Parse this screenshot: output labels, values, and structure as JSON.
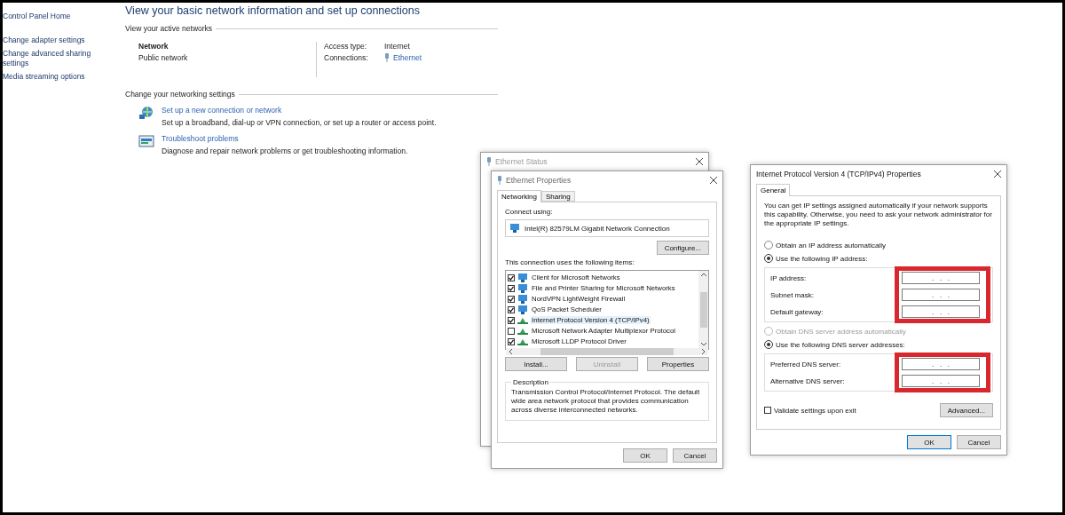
{
  "sidebar": {
    "items": [
      {
        "label": "Control Panel Home"
      },
      {
        "label": "Change adapter settings"
      },
      {
        "label": "Change advanced sharing settings"
      },
      {
        "label": "Media streaming options"
      }
    ]
  },
  "main": {
    "title": "View your basic network information and set up connections",
    "active_heading": "View your active networks",
    "network": {
      "name": "Network",
      "type": "Public network"
    },
    "access": {
      "label": "Access type:",
      "value": "Internet"
    },
    "connections": {
      "label": "Connections:",
      "value": "Ethernet"
    },
    "change_heading": "Change your networking settings",
    "tasks": [
      {
        "kind": "setup",
        "link": "Set up a new connection or network",
        "description": "Set up a broadband, dial-up or VPN connection, or set up a router or access point."
      },
      {
        "kind": "troubleshoot",
        "link": "Troubleshoot problems",
        "description": "Diagnose and repair network problems or get troubleshooting information."
      }
    ]
  },
  "status_window": {
    "title": "Ethernet Status"
  },
  "ethernet_window": {
    "title": "Ethernet Properties",
    "tabs": [
      {
        "label": "Networking",
        "selected": true
      },
      {
        "label": "Sharing",
        "selected": false
      }
    ],
    "connect_label": "Connect using:",
    "adapter": "Intel(R) 82579LM Gigabit Network Connection",
    "configure": "Configure...",
    "items_label": "This connection uses the following items:",
    "items": [
      {
        "kind": "client",
        "label": "Client for Microsoft Networks",
        "checked": true,
        "selected": false
      },
      {
        "kind": "client",
        "label": "File and Printer Sharing for Microsoft Networks",
        "checked": true,
        "selected": false
      },
      {
        "kind": "client",
        "label": "NordVPN LightWeight Firewall",
        "checked": true,
        "selected": false
      },
      {
        "kind": "client",
        "label": "QoS Packet Scheduler",
        "checked": true,
        "selected": false
      },
      {
        "kind": "protocol",
        "label": "Internet Protocol Version 4 (TCP/IPv4)",
        "checked": true,
        "selected": true
      },
      {
        "kind": "protocol",
        "label": "Microsoft Network Adapter Multiplexor Protocol",
        "checked": false,
        "selected": false
      },
      {
        "kind": "protocol",
        "label": "Microsoft LLDP Protocol Driver",
        "checked": true,
        "selected": false
      }
    ],
    "buttons": [
      {
        "label": "Install...",
        "disabled": false
      },
      {
        "label": "Uninstall",
        "disabled": true
      },
      {
        "label": "Properties",
        "disabled": false
      }
    ],
    "description_title": "Description",
    "description": "Transmission Control Protocol/Internet Protocol. The default wide area network protocol that provides communication across diverse interconnected networks.",
    "ok": "OK",
    "cancel": "Cancel"
  },
  "ipv4_window": {
    "title": "Internet Protocol Version 4 (TCP/IPv4) Properties",
    "tabs": [
      {
        "label": "General",
        "selected": true
      }
    ],
    "intro": "You can get IP settings assigned automatically if your network supports this capability. Otherwise, you need to ask your network administrator for the appropriate IP settings.",
    "ip_options": [
      {
        "label": "Obtain an IP address automatically",
        "selected": false,
        "disabled": false
      },
      {
        "label": "Use the following IP address:",
        "selected": true,
        "disabled": false
      }
    ],
    "ip_fields": [
      {
        "label": "IP address:",
        "value": ".   .   ."
      },
      {
        "label": "Subnet mask:",
        "value": ".   .   ."
      },
      {
        "label": "Default gateway:",
        "value": ".   .   ."
      }
    ],
    "ip_highlighted": true,
    "dns_options": [
      {
        "label": "Obtain DNS server address automatically",
        "selected": false,
        "disabled": true
      },
      {
        "label": "Use the following DNS server addresses:",
        "selected": true,
        "disabled": false
      }
    ],
    "dns_fields": [
      {
        "label": "Preferred DNS server:",
        "value": ".   .   ."
      },
      {
        "label": "Alternative DNS server:",
        "value": ".   .   ."
      }
    ],
    "dns_highlighted": true,
    "validate": {
      "label": "Validate settings upon exit",
      "checked": false
    },
    "advanced": "Advanced...",
    "ok": "OK",
    "cancel": "Cancel"
  }
}
